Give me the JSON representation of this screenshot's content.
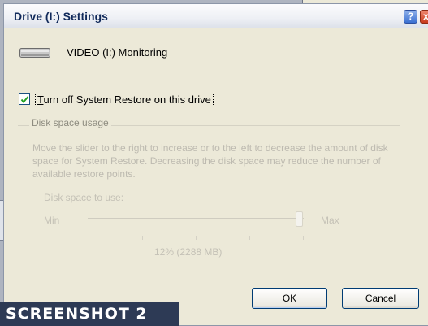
{
  "dialog": {
    "title": "Drive (I:) Settings",
    "help_glyph": "?",
    "close_glyph": "x"
  },
  "drive": {
    "icon": "hard-drive-icon",
    "label": "VIDEO (I:) Monitoring"
  },
  "system_restore": {
    "checked": true,
    "label_mnemonic": "T",
    "label_rest": "urn off System Restore on this drive"
  },
  "disk_space": {
    "group_title": "Disk space usage",
    "description": "Move the slider to the right to increase or to the left to decrease the amount of disk space for System Restore. Decreasing the disk space may reduce the number of available restore points.",
    "use_label": "Disk space to use:",
    "min_label": "Min",
    "max_label": "Max",
    "slider_value_percent": 12,
    "readout": "12% (2288 MB)",
    "enabled": false
  },
  "buttons": {
    "ok": "OK",
    "cancel": "Cancel"
  },
  "overlay_tag": "SCREENSHOT 2",
  "colors": {
    "titlebar_text": "#10295a",
    "dialog_bg": "#ece9d8",
    "disabled_text": "#bdbab0",
    "tag_bg": "#2d3a55"
  }
}
